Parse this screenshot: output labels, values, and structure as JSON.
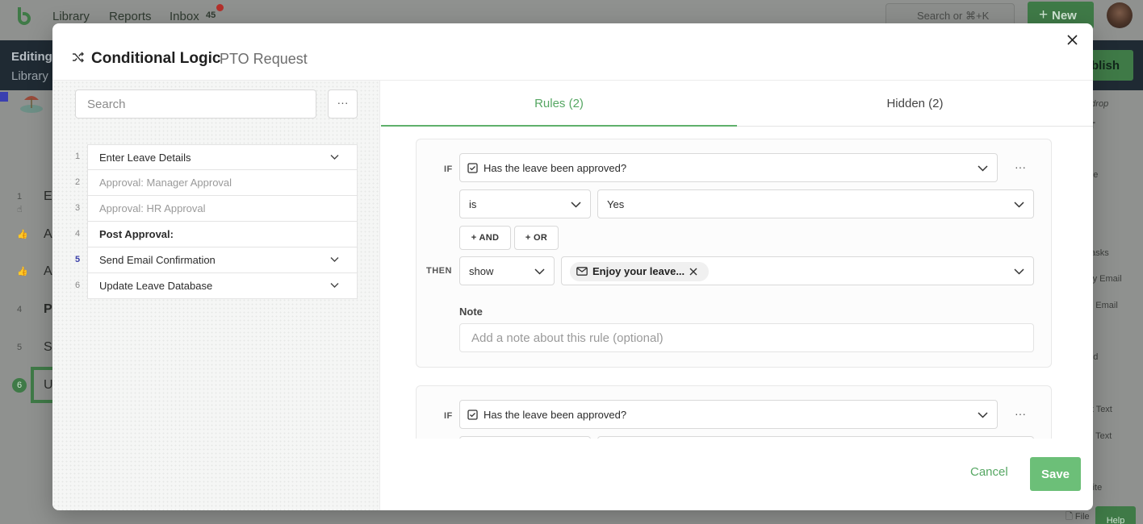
{
  "background": {
    "nav": [
      "Library",
      "Reports",
      "Inbox"
    ],
    "inbox_count": "45",
    "search_placeholder": "Search or ⌘+K",
    "new_label": "New",
    "editing_label": "Editing",
    "library_label": "Library",
    "publish_label": "blish",
    "left_rows": [
      {
        "num": "1",
        "text": "E"
      },
      {
        "num": "",
        "text": "A"
      },
      {
        "num": "",
        "text": "A"
      },
      {
        "num": "4",
        "text": "P"
      },
      {
        "num": "5",
        "text": "S"
      },
      {
        "num": "6",
        "text": "U"
      }
    ],
    "right_items": [
      "d drop",
      "NT",
      "xt",
      "age",
      "eo",
      "e",
      "btasks",
      "acy Email",
      "nd Email",
      "ge",
      "bed",
      "ort Text",
      "ng Text",
      "ail",
      "bsite",
      "File"
    ],
    "help_label": "Help"
  },
  "modal": {
    "title": "Conditional Logic",
    "subtitle": "PTO Request",
    "search_placeholder": "Search",
    "more_label": "···",
    "steps": [
      {
        "num": "1",
        "label": "Enter Leave Details",
        "state": "normal",
        "chevron": true
      },
      {
        "num": "2",
        "label": "Approval: Manager Approval",
        "state": "disabled",
        "chevron": false
      },
      {
        "num": "3",
        "label": "Approval: HR Approval",
        "state": "disabled",
        "chevron": false
      },
      {
        "num": "4",
        "label": "Post Approval:",
        "state": "bold",
        "chevron": false
      },
      {
        "num": "5",
        "label": "Send Email Confirmation",
        "state": "active",
        "chevron": true
      },
      {
        "num": "6",
        "label": "Update Leave Database",
        "state": "normal",
        "chevron": true
      }
    ],
    "tabs": {
      "rules": "Rules (2)",
      "hidden": "Hidden (2)"
    },
    "rules": [
      {
        "if_label": "IF",
        "field": "Has the leave been approved?",
        "operator": "is",
        "value": "Yes",
        "and_label": "AND",
        "or_label": "OR",
        "then_label": "THEN",
        "action": "show",
        "target": "Enjoy your leave...",
        "note_label": "Note",
        "note_placeholder": "Add a note about this rule (optional)"
      },
      {
        "if_label": "IF",
        "field": "Has the leave been approved?"
      }
    ],
    "cancel_label": "Cancel",
    "save_label": "Save"
  },
  "colors": {
    "accent": "#5fb06b",
    "save": "#6cbf78",
    "active_step": "#3a3fa8"
  }
}
